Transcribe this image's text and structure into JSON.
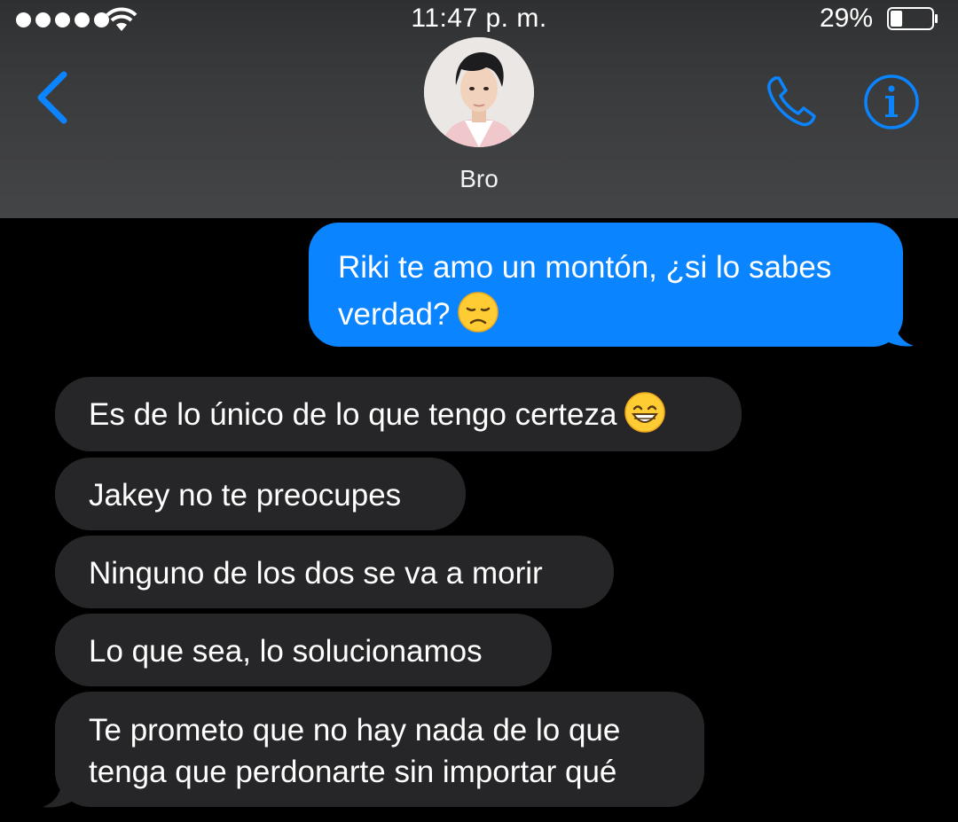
{
  "status_bar": {
    "time": "11:47 p. m.",
    "battery_percent": "29%",
    "battery_level": 0.29,
    "signal_bars": 5
  },
  "header": {
    "contact_name": "Bro",
    "back_icon": "chevron-left-icon",
    "call_icon": "phone-icon",
    "info_icon": "info-icon",
    "accent_color": "#0a84ff"
  },
  "messages": [
    {
      "direction": "sent",
      "lines": [
        "Riki te amo un montón, ¿si lo sabes",
        "verdad?"
      ],
      "emoji": "disappointed-face"
    },
    {
      "direction": "received",
      "text": "Es de lo único de lo que tengo certeza",
      "emoji": "grinning-face-with-smiling-eyes"
    },
    {
      "direction": "received",
      "text": "Jakey no te preocupes"
    },
    {
      "direction": "received",
      "text": "Ninguno de los dos se va a morir"
    },
    {
      "direction": "received",
      "text": "Lo que sea, lo solucionamos"
    },
    {
      "direction": "received",
      "lines": [
        "Te prometo que no hay nada de lo que",
        "tenga que perdonarte sin importar qué"
      ]
    }
  ]
}
